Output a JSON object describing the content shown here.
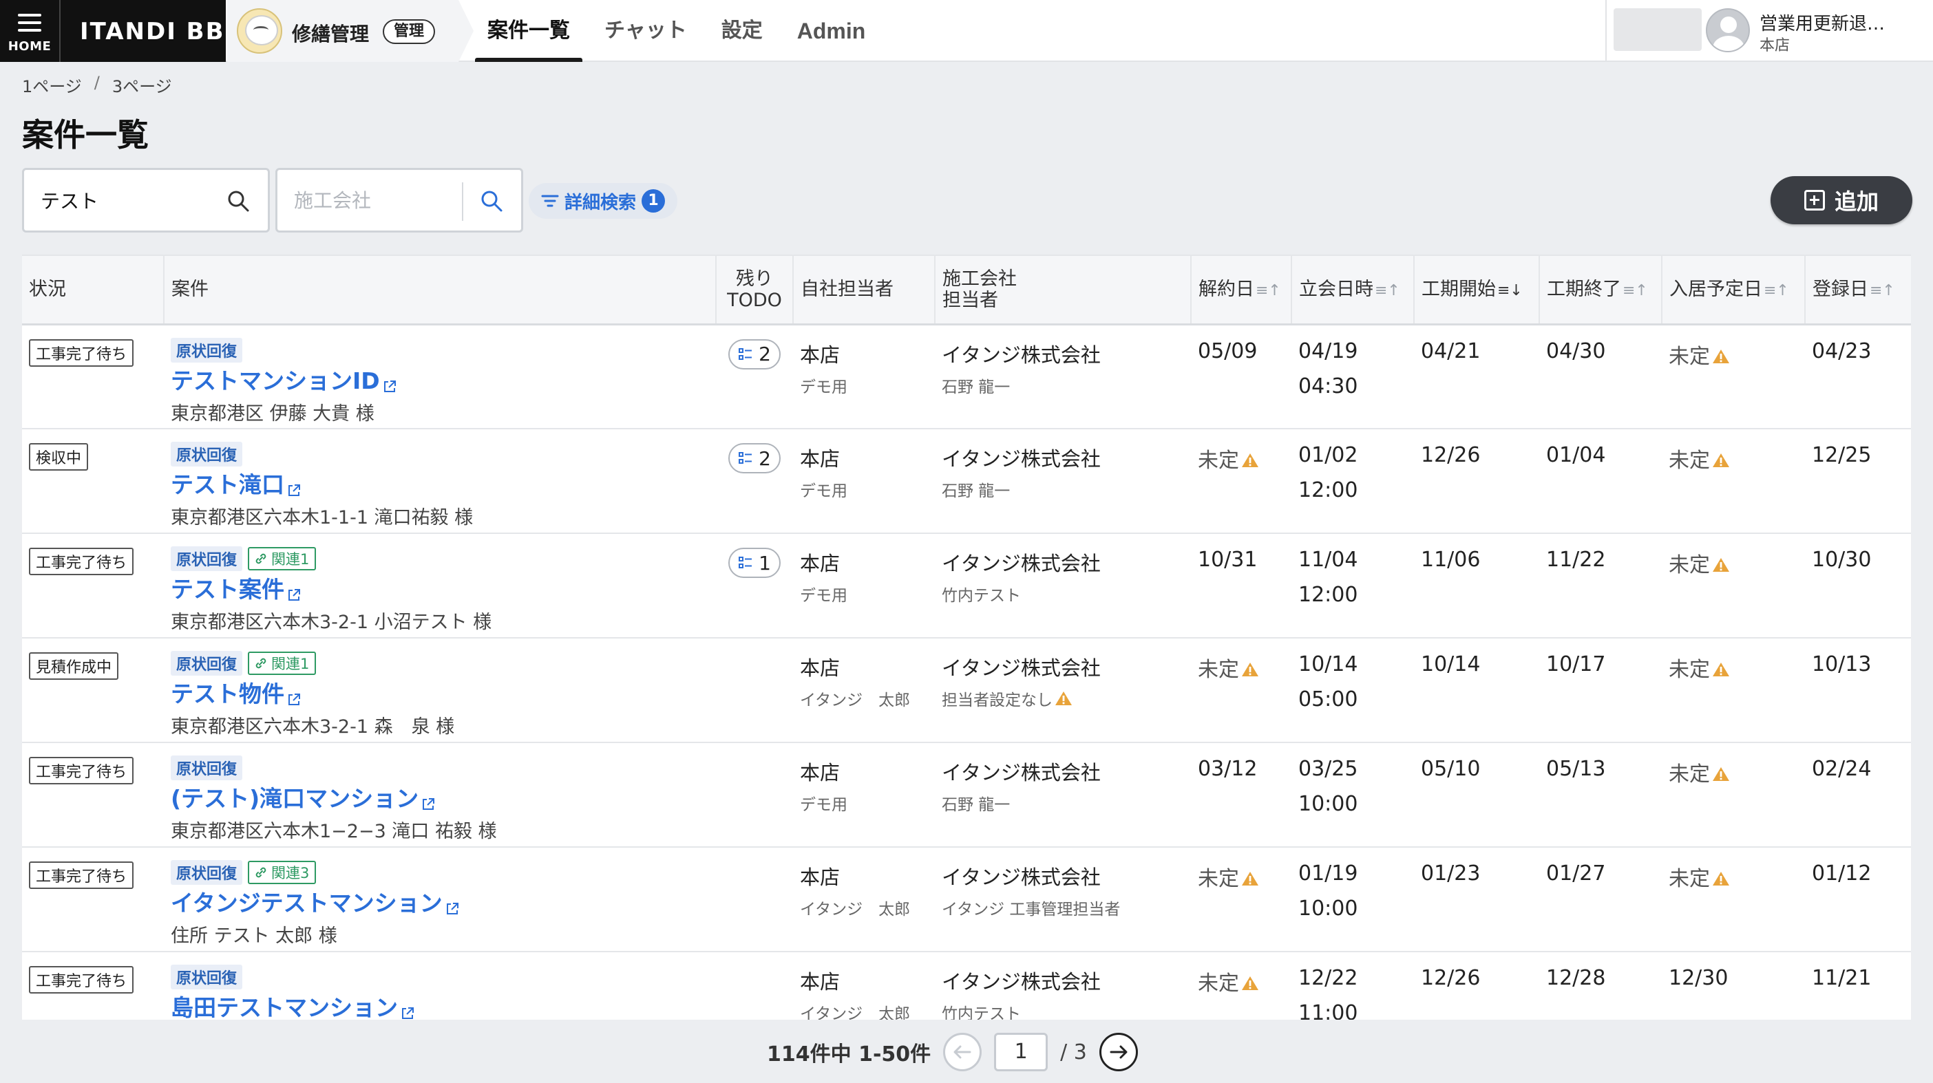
{
  "header": {
    "home_label": "HOME",
    "brand": "ITANDI BB",
    "app_name": "修繕管理",
    "admin_badge": "管理",
    "nav": [
      "案件一覧",
      "チャット",
      "設定",
      "Admin"
    ],
    "user_name": "営業用更新退…",
    "user_branch": "本店"
  },
  "breadcrumb": {
    "first": "1ページ",
    "separator": "/",
    "second": "3ページ"
  },
  "page_title": "案件一覧",
  "search": {
    "keyword_value": "テスト",
    "company_placeholder": "施工会社",
    "advanced_label": "詳細検索",
    "advanced_count": "1",
    "add_label": "追加"
  },
  "table": {
    "headers": {
      "status": "状況",
      "case": "案件",
      "todo_1": "残り",
      "todo_2": "TODO",
      "staff": "自社担当者",
      "contractor_1": "施工会社",
      "contractor_2": "担当者",
      "cancel_date": "解約日",
      "inspection": "立会日時",
      "work_start": "工期開始",
      "work_end": "工期終了",
      "move_in": "入居予定日",
      "registered": "登録日"
    },
    "rows": [
      {
        "status": "工事完了待ち",
        "tag": "原状回復",
        "related": "",
        "title": "テストマンションID",
        "address": "東京都港区 伊藤 大貴 様",
        "todo": "2",
        "staff": "本店",
        "staff_sub": "デモ用",
        "company": "イタンジ株式会社",
        "company_sub": "石野 龍一",
        "cancel": "05/09",
        "insp_date": "04/19",
        "insp_time": "04:30",
        "start": "04/21",
        "end": "04/30",
        "movein": "未定",
        "registered": "04/23"
      },
      {
        "status": "検収中",
        "tag": "原状回復",
        "related": "",
        "title": "テスト滝口",
        "address": "東京都港区六本木1-1-1 滝口祐毅 様",
        "todo": "2",
        "staff": "本店",
        "staff_sub": "デモ用",
        "company": "イタンジ株式会社",
        "company_sub": "石野 龍一",
        "cancel": "未定",
        "insp_date": "01/02",
        "insp_time": "12:00",
        "start": "12/26",
        "end": "01/04",
        "movein": "未定",
        "registered": "12/25"
      },
      {
        "status": "工事完了待ち",
        "tag": "原状回復",
        "related": "関連1",
        "title": "テスト案件",
        "address": "東京都港区六本木3-2-1 小沼テスト 様",
        "todo": "1",
        "staff": "本店",
        "staff_sub": "デモ用",
        "company": "イタンジ株式会社",
        "company_sub": "竹内テスト",
        "cancel": "10/31",
        "insp_date": "11/04",
        "insp_time": "12:00",
        "start": "11/06",
        "end": "11/22",
        "movein": "未定",
        "registered": "10/30"
      },
      {
        "status": "見積作成中",
        "tag": "原状回復",
        "related": "関連1",
        "title": "テスト物件",
        "address": "東京都港区六本木3-2-1 森　泉 様",
        "todo": "",
        "staff": "本店",
        "staff_sub": "イタンジ　太郎",
        "company": "イタンジ株式会社",
        "company_sub": "担当者設定なし",
        "cancel": "未定",
        "insp_date": "10/14",
        "insp_time": "05:00",
        "start": "10/14",
        "end": "10/17",
        "movein": "未定",
        "registered": "10/13"
      },
      {
        "status": "工事完了待ち",
        "tag": "原状回復",
        "related": "",
        "title": "(テスト)滝口マンション",
        "address": "東京都港区六本木1−2−3 滝口 祐毅 様",
        "todo": "",
        "staff": "本店",
        "staff_sub": "デモ用",
        "company": "イタンジ株式会社",
        "company_sub": "石野 龍一",
        "cancel": "03/12",
        "insp_date": "03/25",
        "insp_time": "10:00",
        "start": "05/10",
        "end": "05/13",
        "movein": "未定",
        "registered": "02/24"
      },
      {
        "status": "工事完了待ち",
        "tag": "原状回復",
        "related": "関連3",
        "title": "イタンジテストマンション",
        "address": "住所 テスト 太郎 様",
        "todo": "",
        "staff": "本店",
        "staff_sub": "イタンジ　太郎",
        "company": "イタンジ株式会社",
        "company_sub": "イタンジ 工事管理担当者",
        "cancel": "未定",
        "insp_date": "01/19",
        "insp_time": "10:00",
        "start": "01/23",
        "end": "01/27",
        "movein": "未定",
        "registered": "01/12"
      },
      {
        "status": "工事完了待ち",
        "tag": "原状回復",
        "related": "",
        "title": "島田テストマンション",
        "address": "",
        "todo": "",
        "staff": "本店",
        "staff_sub": "イタンジ　太郎",
        "company": "イタンジ株式会社",
        "company_sub": "竹内テスト",
        "cancel": "未定",
        "insp_date": "12/22",
        "insp_time": "11:00",
        "start": "12/26",
        "end": "12/28",
        "movein": "12/30",
        "registered": "11/21"
      }
    ]
  },
  "pagination": {
    "count_text": "114件中 1-50件",
    "current_page": "1",
    "total_text": "/ 3"
  },
  "colors": {
    "accent": "#2a6ed8",
    "warning": "#e8a33a",
    "related": "#2e9a63",
    "dark": "#111111"
  }
}
